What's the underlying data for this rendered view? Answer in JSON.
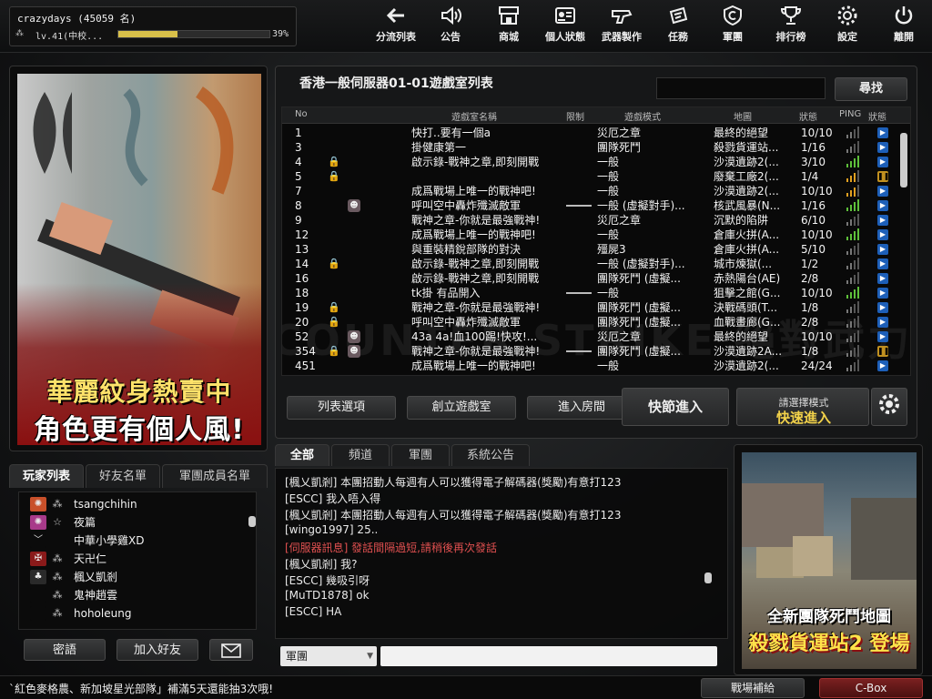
{
  "user": {
    "name": "crazydays (45059 名)",
    "level_text": "lv.41(中校...",
    "exp_pct_label": "39%",
    "exp_progress": 0.39
  },
  "nav": [
    {
      "label": "分流列表",
      "icon": "back-arrow-icon"
    },
    {
      "label": "公告",
      "icon": "speaker-icon"
    },
    {
      "label": "商城",
      "icon": "shop-icon"
    },
    {
      "label": "個人狀態",
      "icon": "profile-card-icon"
    },
    {
      "label": "武器製作",
      "icon": "weapon-craft-icon"
    },
    {
      "label": "任務",
      "icon": "mission-icon"
    },
    {
      "label": "軍團",
      "icon": "clan-icon"
    },
    {
      "label": "排行榜",
      "icon": "trophy-icon"
    },
    {
      "label": "設定",
      "icon": "gear-icon"
    },
    {
      "label": "離開",
      "icon": "power-icon"
    }
  ],
  "promo": {
    "line1": "華麗紋身熱賣中",
    "line2": "角色更有個人風!"
  },
  "room_panel": {
    "title": "香港一般伺服器01-01遊戲室列表",
    "search_label": "尋找",
    "columns": [
      "No",
      "遊戲室名稱",
      "限制",
      "遊戲模式",
      "地圖",
      "狀態",
      "PING",
      "狀態"
    ],
    "rows": [
      {
        "no": "1",
        "lock": false,
        "limit_icon": false,
        "gun": false,
        "name": "快打..要有一個a",
        "mode": "災厄之章",
        "map": "最終的絕望",
        "status": "10/10",
        "ping": 2,
        "state": "play"
      },
      {
        "no": "3",
        "lock": false,
        "limit_icon": false,
        "gun": false,
        "name": "掛健康第一",
        "mode": "團隊死鬥",
        "map": "殺戮貨運站...",
        "status": "1/16",
        "ping": 2,
        "state": "play"
      },
      {
        "no": "4",
        "lock": true,
        "limit_icon": false,
        "gun": false,
        "name": "啟示錄-戰神之章,即刻開戰",
        "mode": "一般",
        "map": "沙漠遺跡2(...",
        "status": "3/10",
        "ping": 4,
        "state": "play"
      },
      {
        "no": "5",
        "lock": true,
        "limit_icon": false,
        "gun": false,
        "name": "",
        "mode": "一般",
        "map": "廢棄工廠2(...",
        "status": "1/4",
        "ping": 3,
        "state": "wait"
      },
      {
        "no": "7",
        "lock": false,
        "limit_icon": false,
        "gun": false,
        "name": "成爲戰場上唯一的戰神吧!",
        "mode": "一般",
        "map": "沙漠遺跡2(...",
        "status": "10/10",
        "ping": 3,
        "state": "play"
      },
      {
        "no": "8",
        "lock": false,
        "limit_icon": true,
        "gun": true,
        "name": "呼叫空中轟炸殲滅敵軍",
        "mode": "一般 (虛擬對手)...",
        "map": "核武風暴(N...",
        "status": "1/16",
        "ping": 4,
        "state": "play"
      },
      {
        "no": "9",
        "lock": false,
        "limit_icon": false,
        "gun": false,
        "name": "戰神之章-你就是最強戰神!",
        "mode": "災厄之章",
        "map": "沉默的陷阱",
        "status": "6/10",
        "ping": 2,
        "state": "play"
      },
      {
        "no": "12",
        "lock": false,
        "limit_icon": false,
        "gun": false,
        "name": "成爲戰場上唯一的戰神吧!",
        "mode": "一般",
        "map": "倉庫火拼(A...",
        "status": "10/10",
        "ping": 4,
        "state": "play"
      },
      {
        "no": "13",
        "lock": false,
        "limit_icon": false,
        "gun": false,
        "name": "與重裝精銳部隊的對決",
        "mode": "殭屍3",
        "map": "倉庫火拼(A...",
        "status": "5/10",
        "ping": 2,
        "state": "play"
      },
      {
        "no": "14",
        "lock": true,
        "limit_icon": false,
        "gun": false,
        "name": "啟示錄-戰神之章,即刻開戰",
        "mode": "一般 (虛擬對手)...",
        "map": "城市煉獄(...",
        "status": "1/2",
        "ping": 2,
        "state": "play"
      },
      {
        "no": "16",
        "lock": false,
        "limit_icon": false,
        "gun": false,
        "name": "啟示錄-戰神之章,即刻開戰",
        "mode": "團隊死鬥 (虛擬...",
        "map": "赤熱陽台(AE)",
        "status": "2/8",
        "ping": 2,
        "state": "play"
      },
      {
        "no": "18",
        "lock": false,
        "limit_icon": false,
        "gun": true,
        "name": "tk掛 有品開入",
        "mode": "一般",
        "map": "狙擊之館(G...",
        "status": "10/10",
        "ping": 4,
        "state": "play"
      },
      {
        "no": "19",
        "lock": true,
        "limit_icon": false,
        "gun": false,
        "name": "戰神之章-你就是最強戰神!",
        "mode": "團隊死鬥 (虛擬...",
        "map": "決戰碼頭(T...",
        "status": "1/8",
        "ping": 2,
        "state": "play"
      },
      {
        "no": "20",
        "lock": true,
        "limit_icon": false,
        "gun": false,
        "name": "呼叫空中轟炸殲滅敵軍",
        "mode": "團隊死鬥 (虛擬...",
        "map": "血戰畫廊(G...",
        "status": "2/8",
        "ping": 2,
        "state": "play"
      },
      {
        "no": "52",
        "lock": false,
        "limit_icon": true,
        "gun": false,
        "name": "43a 4a!血100踢!快攻!...",
        "mode": "災厄之章",
        "map": "最終的絕望",
        "status": "10/10",
        "ping": 2,
        "state": "play"
      },
      {
        "no": "354",
        "lock": true,
        "limit_icon": true,
        "gun": true,
        "name": "戰神之章-你就是最強戰神!",
        "mode": "團隊死鬥 (虛擬...",
        "map": "沙漠遺跡2A...",
        "status": "1/8",
        "ping": 2,
        "state": "wait"
      },
      {
        "no": "451",
        "lock": false,
        "limit_icon": false,
        "gun": false,
        "name": "成爲戰場上唯一的戰神吧!",
        "mode": "一般",
        "map": "沙漠遺跡2(...",
        "status": "24/24",
        "ping": 2,
        "state": "play"
      }
    ],
    "watermark": "COUNTER STRIKE 絕對武力",
    "btn_list_options": "列表選項",
    "btn_create_room": "創立遊戲室",
    "btn_enter_room": "進入房間",
    "btn_quick_join": "快節進入",
    "mode_select_label": "請選擇模式",
    "mode_quick_label": "快速進入"
  },
  "player_panel": {
    "tabs": [
      "玩家列表",
      "好友名單",
      "軍團成員名單"
    ],
    "players": [
      {
        "name": "tsangchihin",
        "c1": "#c8502a",
        "g1": "✺",
        "g2": "⁂"
      },
      {
        "name": "夜篇",
        "c1": "#a83a8a",
        "g1": "✺",
        "g2": "☆"
      },
      {
        "name": "中華小學雞XD",
        "c1": "#0b0b0b",
        "g1": "﹀",
        "g2": ""
      },
      {
        "name": "天卍仁",
        "c1": "#8a1a1a",
        "g1": "✠",
        "g2": "⁂"
      },
      {
        "name": "楓乂凱剎",
        "c1": "#2a2a2a",
        "g1": "♣",
        "g2": "⁂"
      },
      {
        "name": "鬼神趙雲",
        "c1": "#0b0b0b",
        "g1": "",
        "g2": "⁂"
      },
      {
        "name": "hoholeung",
        "c1": "#0b0b0b",
        "g1": "",
        "g2": "⁂"
      }
    ],
    "btn_password": "密語",
    "btn_add_friend": "加入好友",
    "mail_icon": "mail-icon"
  },
  "chat": {
    "tabs": [
      "全部",
      "頻道",
      "軍團",
      "系統公告"
    ],
    "lines": [
      {
        "text": "[楓乂凱剎] 本團招動人每週有人可以獲得電子解碼器(獎勵)有意打123",
        "sys": false
      },
      {
        "text": "[ESCC] 我入唔入得",
        "sys": false
      },
      {
        "text": "[楓乂凱剎] 本團招動人每週有人可以獲得電子解碼器(獎勵)有意打123",
        "sys": false
      },
      {
        "text": "[wingo1997] 25..",
        "sys": false
      },
      {
        "text": "[伺服器訊息] 發話間隔過短,請稍後再次發話",
        "sys": true
      },
      {
        "text": "[楓乂凱剎] 我?",
        "sys": false
      },
      {
        "text": "[ESCC] 幾吸引呀",
        "sys": false
      },
      {
        "text": "[MuTD1878] ok",
        "sys": false
      },
      {
        "text": "[ESCC] HA",
        "sys": false
      }
    ],
    "channel_select": "軍團"
  },
  "map_promo": {
    "line1": "全新團隊死鬥地圖",
    "line2": "殺戮貨運站2 登場"
  },
  "footer": {
    "text": "`紅色麥格農、新加坡星光部隊」補滿5天還能抽3次哦!",
    "btn_supply": "戰場補給",
    "btn_cbox": "C-Box"
  }
}
